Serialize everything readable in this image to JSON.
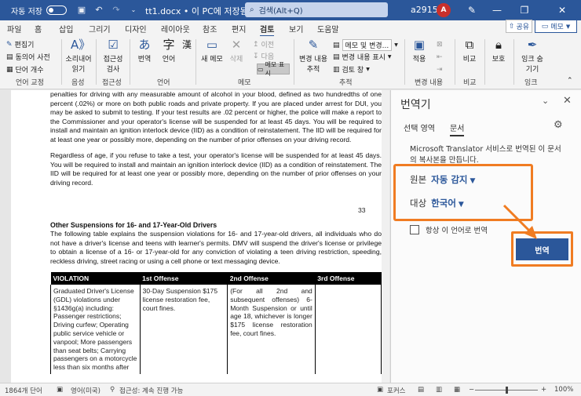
{
  "titlebar": {
    "autosave_label": "자동 저장",
    "autosave_state": "끔",
    "doc_title": "tt1.docx • 이 PC에 저장됨 ⌄",
    "search_placeholder": "검색(Alt+Q)",
    "user_name": "a2915",
    "avatar_initial": "A"
  },
  "menu": {
    "tabs": [
      "파일",
      "홈",
      "삽입",
      "그리기",
      "디자인",
      "레이아웃",
      "참조",
      "편지",
      "검토",
      "보기",
      "도움말"
    ],
    "active": "검토",
    "share_label": "공유",
    "memo_label": "메모"
  },
  "ribbon": {
    "proofing": {
      "items": [
        "편집기",
        "동의어 사전",
        "단어 개수"
      ],
      "label": "언어 교정"
    },
    "speech": {
      "read_aloud": "소리내어\n읽기",
      "label": "음성"
    },
    "accessibility": {
      "check": "접근성\n검사",
      "label": "접근성"
    },
    "language": {
      "translate": "번역",
      "language": "언어",
      "label": "언어"
    },
    "comments": {
      "new": "새 메모",
      "delete": "삭제",
      "prev": "이전",
      "next": "다음",
      "show": "메모 표시",
      "label": "메모"
    },
    "tracking": {
      "track_changes": "변경 내용\n추적",
      "markup": "메모 및 변경...",
      "show_markup": "변경 내용 표시",
      "review_pane": "검토 창",
      "label": "추적"
    },
    "changes": {
      "accept": "적용",
      "label": "변경 내용"
    },
    "compare": {
      "compare": "비교",
      "label": "비교"
    },
    "protect": {
      "protect": "보호"
    },
    "ink": {
      "hide_ink": "잉크 숨\n기기",
      "label": "잉크"
    }
  },
  "document": {
    "para1": "penalties for driving with any measurable amount of alcohol in your blood, defined as two hundredths of one percent (.02%) or more on both public roads and private property. If you are placed under arrest for DUI, you may be asked to submit to testing. If your test results are .02 percent or higher, the police will make a report to the Commissioner and your operator's license will be suspended for at least 45 days. You will be required to install and maintain an ignition interlock device (IID) as a condition of reinstatement. The IID will be required for at least one year or possibly more, depending on the number of prior offenses on your driving record.",
    "para2": "Regardless of age, if you refuse to take a test, your operator's license will be suspended for at least 45 days. You will be required to install and maintain an ignition interlock device (IID) as a condition of reinstatement. The IID will be required for at least one year or possibly more, depending on the number of prior offenses on your driving record.",
    "page_number": "33",
    "heading": "Other Suspensions for 16- and 17-Year-Old Drivers",
    "para3": "The following table explains the suspension violations for 16- and 17-year-old drivers, all individuals who do not have a driver's license and teens with learner's permits. DMV will suspend the driver's license or privilege to obtain a license of a 16- or 17-year-old for any conviction of violating a teen driving restriction, speeding, reckless driving, street racing or using a cell phone or text messaging device.",
    "table": {
      "headers": [
        "VIOLATION",
        "1st Offense",
        "2nd Offense",
        "3rd Offense"
      ],
      "row": [
        "Graduated Driver's License (GDL) violations under §1436g(a) including: Passenger restrictions; Driving curfew; Operating public service vehicle or vanpool; More passengers than seat belts; Carrying passengers on a motorcycle less than six months after",
        "30-Day Suspension $175 license restoration fee, court fines.",
        "(For all 2nd and subsequent offenses) 6-Month Suspension or until age 18, whichever is longer $175 license restoration fee, court fines.",
        ""
      ]
    }
  },
  "translator": {
    "title": "번역기",
    "tabs": [
      "선택 영역",
      "문서"
    ],
    "active_tab": "문서",
    "description": "Microsoft Translator 서비스로 번역된 이 문서의 복사본을 만듭니다.",
    "source_label": "원본",
    "source_value": "자동 감지",
    "target_label": "대상",
    "target_value": "한국어",
    "always_label": "항상 이 언어로 번역",
    "translate_button": "번역",
    "highlight_color": "#f07c22",
    "accent_color": "#2b579a"
  },
  "status": {
    "word_count": "1864개 단어",
    "language": "영어(미국)",
    "accessibility": "접근성: 계속 진행 가능",
    "focus": "포커스",
    "zoom": "100%"
  }
}
